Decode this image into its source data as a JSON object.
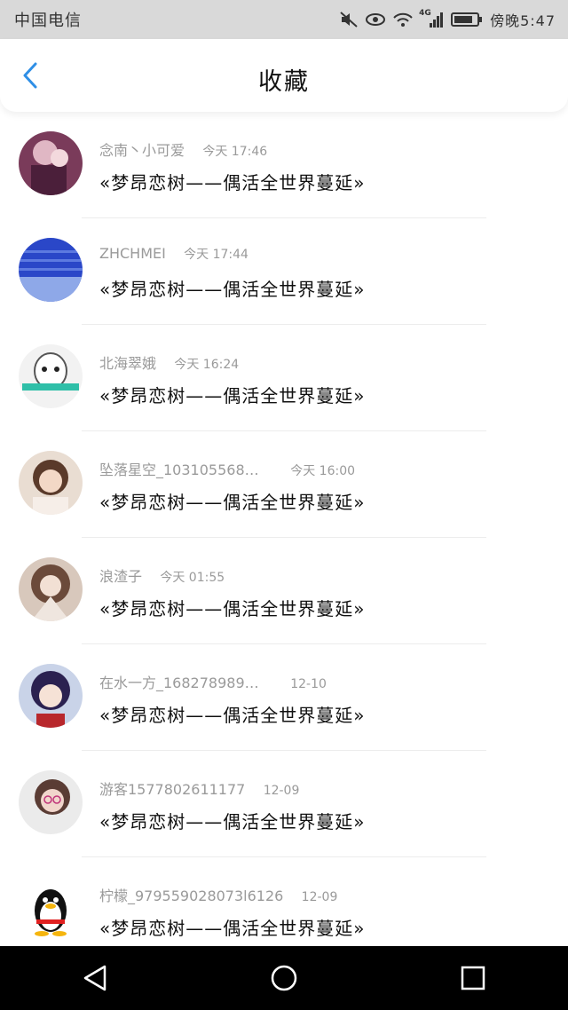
{
  "status_bar": {
    "carrier": "中国电信",
    "network": "4G",
    "time": "傍晚5:47",
    "icons": [
      "mute-icon",
      "eye-icon",
      "wifi-icon",
      "signal-icon",
      "battery-icon"
    ]
  },
  "header": {
    "title": "收藏",
    "back_icon": "chevron-left-icon",
    "accent": "#2f8fe6"
  },
  "favorites": [
    {
      "name": "念南丶小可爱",
      "time": "今天 17:46",
      "content": "«梦昂恋树——偶活全世界蔓延»"
    },
    {
      "name": "ZHCHMEI",
      "time": "今天 17:44",
      "content": "«梦昂恋树——偶活全世界蔓延»"
    },
    {
      "name": "北海翠娥",
      "time": "今天 16:24",
      "content": "«梦昂恋树——偶活全世界蔓延»"
    },
    {
      "name": "坠落星空_103105568…",
      "time": "今天 16:00",
      "content": "«梦昂恋树——偶活全世界蔓延»"
    },
    {
      "name": "浪渣子",
      "time": "今天 01:55",
      "content": "«梦昂恋树——偶活全世界蔓延»"
    },
    {
      "name": "在水一方_168278989…",
      "time": "12-10",
      "content": "«梦昂恋树——偶活全世界蔓延»"
    },
    {
      "name": "游客1577802611177",
      "time": "12-09",
      "content": "«梦昂恋树——偶活全世界蔓延»"
    },
    {
      "name": "柠檬_979559028073l6126",
      "time": "12-09",
      "content": "«梦昂恋树——偶活全世界蔓延»"
    }
  ],
  "nav_bar": {
    "icons": [
      "back-triangle-icon",
      "home-circle-icon",
      "recents-square-icon"
    ]
  }
}
